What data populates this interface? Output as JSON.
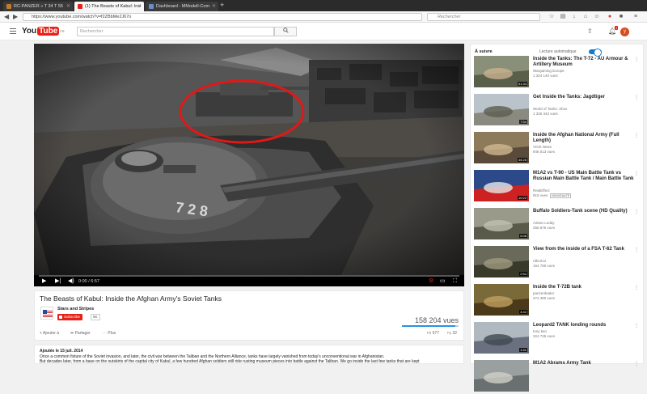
{
  "browser": {
    "tabs": [
      {
        "title": "RC-PANZER » T 34 T 55",
        "favicon_color": "#c47a2c"
      },
      {
        "title": "(1) The Beasts of Kabul: Insi",
        "favicon_color": "#e62117"
      },
      {
        "title": "Dashboard - MModell-Com",
        "favicon_color": "#6a8cc7"
      }
    ],
    "url": "https://www.youtube.com/watch?v=f2ZBbMe2J67o",
    "search_placeholder": "Rechercher"
  },
  "yt": {
    "logo_you": "You",
    "logo_tube": "Tube",
    "logo_region": "FR",
    "search_placeholder": "Rechercher",
    "notification_count": "1",
    "avatar_letter": "y"
  },
  "player": {
    "time": "0:00 / 6:57",
    "progress_fraction": 0
  },
  "video": {
    "title": "The Beasts of Kabul: Inside the Afghan Army's Soviet Tanks",
    "channel": "Stars and Stripes",
    "subscribe_label": "Subscribe",
    "subscribe_count": "5K",
    "views": "158 204 vues",
    "add_label": "Ajouter à",
    "share_label": "Partager",
    "more_label": "Plus",
    "likes": "577",
    "dislikes": "32"
  },
  "description": {
    "date": "Ajoutée le 15 juil. 2014",
    "line1": "Once a common fixture of the Soviet invasion, and later, the civil war between the Taliban and the Northern Alliance, tanks have largely vanished from today's unconventional war in Afghanistan.",
    "line2": "But decades later, from a base on the outskirts of the capital city of Kabul, a few hundred Afghan soldiers still ride rusting museum pieces into battle against the Taliban. We go inside the last few tanks that are kept"
  },
  "sidebar": {
    "up_next": "À suivre",
    "autoplay_label": "Lecture automatique",
    "items": [
      {
        "title": "Inside the Tanks: The T-72 - AU Armour & Artillery Museum",
        "channel": "Wargaming Europe",
        "views": "1 324 140 vues",
        "duration": "51:34",
        "badge": ""
      },
      {
        "title": "Get Inside the Tanks: Jagdtiger",
        "channel": "World of Tanks: Xbox",
        "views": "1 326 343 vues",
        "duration": "7:54",
        "badge": ""
      },
      {
        "title": "Inside the Afghan National Army (Full Length)",
        "channel": "VICE News",
        "views": "946 013 vues",
        "duration": "45:28",
        "badge": ""
      },
      {
        "title": "M1A2 vs T-90 - US Main Battle Tank vs Russian Main Battle Tank / Main Battle Tank",
        "channel": "RealEffect",
        "views": "915 vues",
        "duration": "10:22",
        "badge": "NOUVEAUTÉ"
      },
      {
        "title": "Buffalo Soldiers-Tank scene (HD Quality)",
        "channel": "Adnan Leddy",
        "views": "265 876 vues",
        "duration": "5:08",
        "badge": ""
      },
      {
        "title": "View from the inside of a FSA T-62 Tank",
        "channel": "rdkrol12",
        "views": "164 780 vues",
        "duration": "2:54",
        "badge": ""
      },
      {
        "title": "Inside the T-72B tank",
        "channel": "panzerdealer",
        "views": "274 380 vues",
        "duration": "4:44",
        "badge": ""
      },
      {
        "title": "Leopard2 TANK londing rounds",
        "channel": "tony ken",
        "views": "324 735 vues",
        "duration": "1:41",
        "badge": ""
      },
      {
        "title": "M1A2 Abrams Army Tank",
        "channel": "",
        "views": "",
        "duration": "",
        "badge": ""
      }
    ]
  }
}
